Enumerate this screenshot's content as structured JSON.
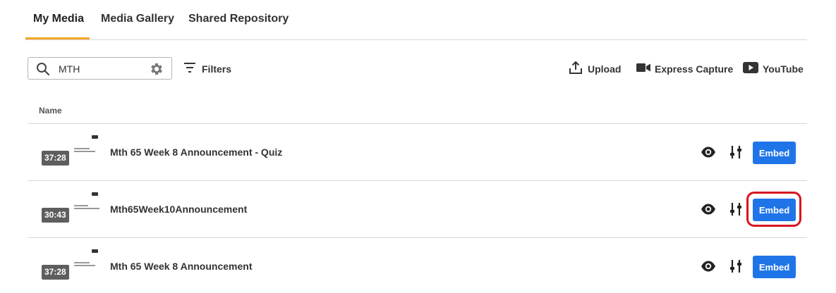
{
  "tabs": [
    {
      "label": "My Media",
      "active": true
    },
    {
      "label": "Media Gallery",
      "active": false
    },
    {
      "label": "Shared Repository",
      "active": false
    }
  ],
  "accent_color": "#f0a826",
  "search": {
    "value": "MTH",
    "icon": "search-icon",
    "settings_icon": "gear-icon"
  },
  "filters": {
    "label": "Filters",
    "icon": "filter-lines-icon"
  },
  "actions": {
    "upload": {
      "label": "Upload",
      "icon": "upload-icon"
    },
    "express_capture": {
      "label": "Express Capture",
      "icon": "video-camera-icon"
    },
    "youtube": {
      "label": "YouTube",
      "icon": "youtube-icon"
    }
  },
  "table": {
    "column_header": "Name",
    "rows": [
      {
        "duration": "37:28",
        "title": "Mth 65 Week 8 Announcement - Quiz",
        "embed_label": "Embed"
      },
      {
        "duration": "30:43",
        "title": "Mth65Week10Announcement",
        "embed_label": "Embed",
        "highlighted": true
      },
      {
        "duration": "37:28",
        "title": "Mth 65 Week 8 Announcement",
        "embed_label": "Embed"
      }
    ]
  },
  "colors": {
    "embed_button": "#1f75e8",
    "highlight_ring": "#d7161f"
  }
}
